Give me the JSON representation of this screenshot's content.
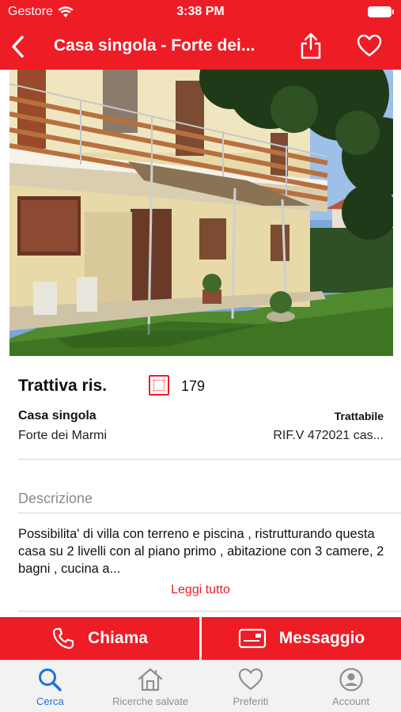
{
  "status_bar": {
    "carrier": "Gestore",
    "time": "3:38 PM",
    "wifi_icon": "wifi-icon",
    "battery_icon": "battery-icon"
  },
  "navbar": {
    "title": "Casa singola - Forte dei...",
    "back_icon": "chevron-left-icon",
    "share_icon": "share-icon",
    "favorite_icon": "heart-icon",
    "background": "#ee1c25"
  },
  "photo": {
    "icon": "house-photo"
  },
  "listing": {
    "price": "Trattiva ris.",
    "surface_icon": "surface-area-icon",
    "surface": "179",
    "type": "Casa singola",
    "negotiable": "Trattabile",
    "city": "Forte dei Marmi",
    "reference": "RIF.V 472021 cas..."
  },
  "description": {
    "heading": "Descrizione",
    "text": "Possibilita' di villa con terreno e piscina , ristrutturando questa casa su 2 livelli con al piano primo , abitazione con 3 camere, 2 bagni , cucina a...",
    "read_more": "Leggi tutto"
  },
  "actions": {
    "call_label": "Chiama",
    "call_icon": "phone-icon",
    "message_label": "Messaggio",
    "message_icon": "message-card-icon"
  },
  "tabbar": {
    "active_color": "#1a73d9",
    "items": [
      {
        "label": "Cerca",
        "icon": "search-icon",
        "active": true
      },
      {
        "label": "Ricerche salvate",
        "icon": "home-icon",
        "active": false
      },
      {
        "label": "Preferiti",
        "icon": "heart-icon",
        "active": false
      },
      {
        "label": "Account",
        "icon": "account-icon",
        "active": false
      }
    ]
  }
}
